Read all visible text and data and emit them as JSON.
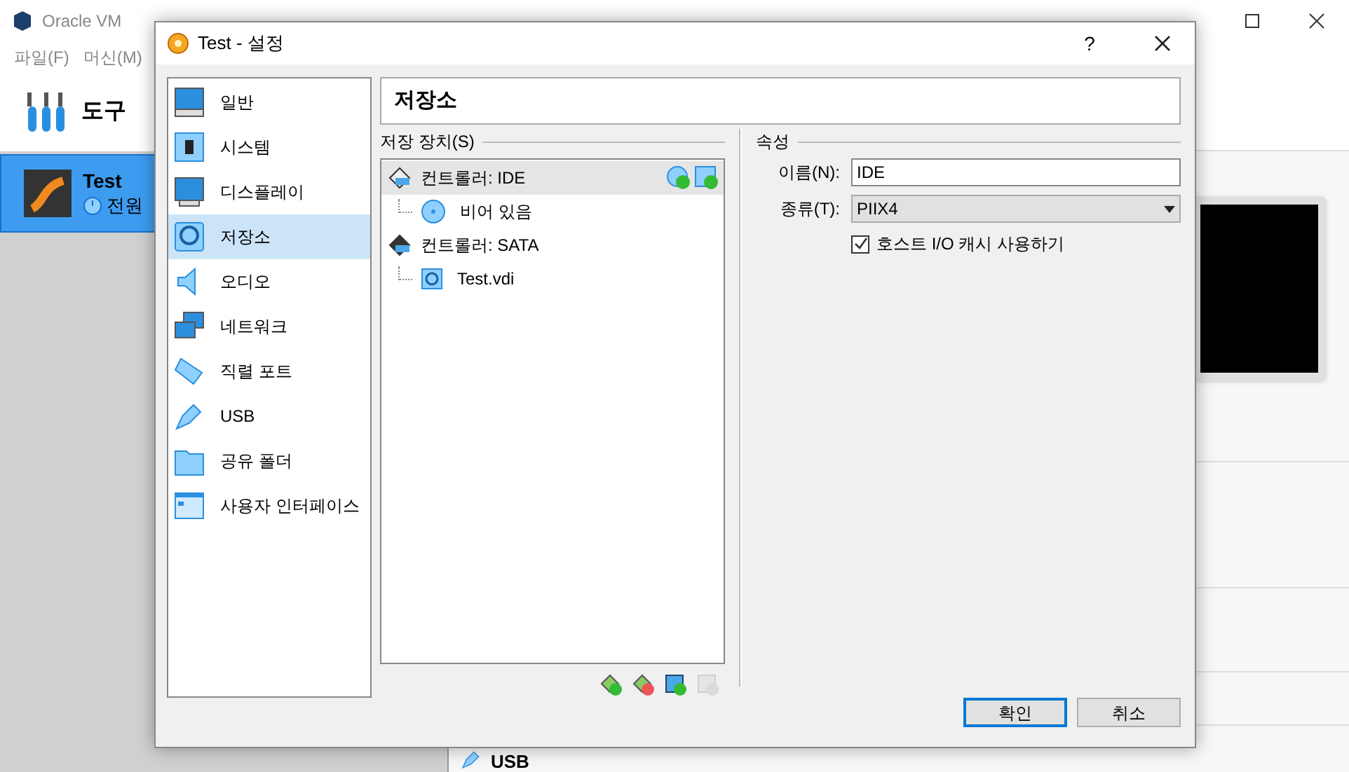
{
  "background_window": {
    "title": "Oracle VM",
    "menu": [
      "파일(F)",
      "머신(M)"
    ],
    "tools_label": "도구",
    "vm": {
      "name": "Test",
      "state": "전원",
      "selected": true
    },
    "usb_heading": "USB"
  },
  "dialog": {
    "title": "Test - 설정",
    "help": "?",
    "sections": [
      {
        "label": "일반",
        "selected": false
      },
      {
        "label": "시스템",
        "selected": false
      },
      {
        "label": "디스플레이",
        "selected": false
      },
      {
        "label": "저장소",
        "selected": true
      },
      {
        "label": "오디오",
        "selected": false
      },
      {
        "label": "네트워크",
        "selected": false
      },
      {
        "label": "직렬 포트",
        "selected": false
      },
      {
        "label": "USB",
        "selected": false
      },
      {
        "label": "공유 폴더",
        "selected": false
      },
      {
        "label": "사용자 인터페이스",
        "selected": false
      }
    ],
    "page_title": "저장소",
    "storage": {
      "label": "저장 장치(S)",
      "controllers": [
        {
          "name": "컨트롤러: IDE",
          "kind": "ide",
          "selected": true,
          "children": [
            {
              "name": "비어 있음",
              "kind": "optical",
              "selected": false
            }
          ]
        },
        {
          "name": "컨트롤러: SATA",
          "kind": "sata",
          "selected": false,
          "children": [
            {
              "name": "Test.vdi",
              "kind": "disk",
              "selected": false
            }
          ]
        }
      ],
      "toolbar": [
        {
          "kind": "add-controller",
          "disabled": false
        },
        {
          "kind": "remove-controller",
          "disabled": false
        },
        {
          "kind": "add-attachment",
          "disabled": false
        },
        {
          "kind": "remove-attachment",
          "disabled": true
        }
      ]
    },
    "attributes": {
      "label": "속성",
      "name_label": "이름(N):",
      "name_value": "IDE",
      "type_label": "종류(T):",
      "type_value": "PIIX4",
      "host_cache": {
        "label": "호스트 I/O 캐시 사용하기",
        "checked": true
      }
    },
    "buttons": [
      {
        "label": "확인",
        "default": true
      },
      {
        "label": "취소",
        "default": false
      }
    ]
  }
}
